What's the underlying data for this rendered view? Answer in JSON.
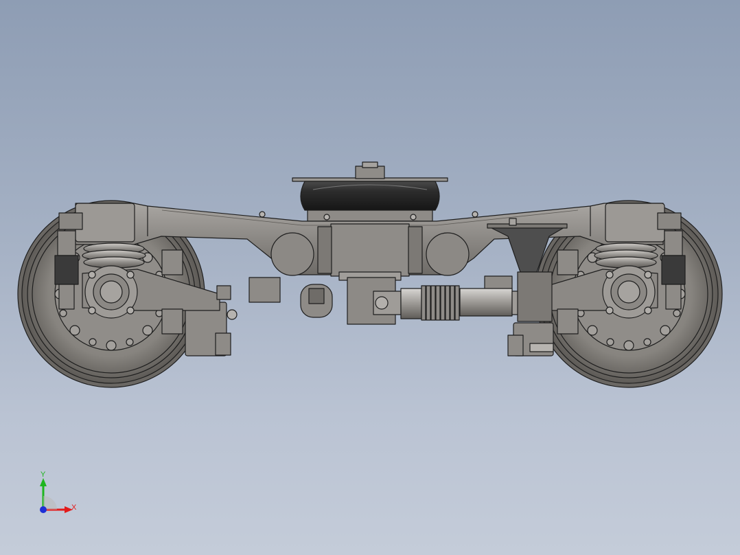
{
  "triad": {
    "x_label": "X",
    "y_label": "Y",
    "x_color": "#e31b1b",
    "y_color": "#1fb51f",
    "z_color": "#1d2fd6"
  },
  "colors": {
    "background_top": "#8e9db4",
    "background_bottom": "#c4ccd9",
    "steel": "#8d8a86",
    "steel_dark": "#5c5955",
    "edge": "#1e1e1e",
    "rubber": "#2b2b2b"
  }
}
